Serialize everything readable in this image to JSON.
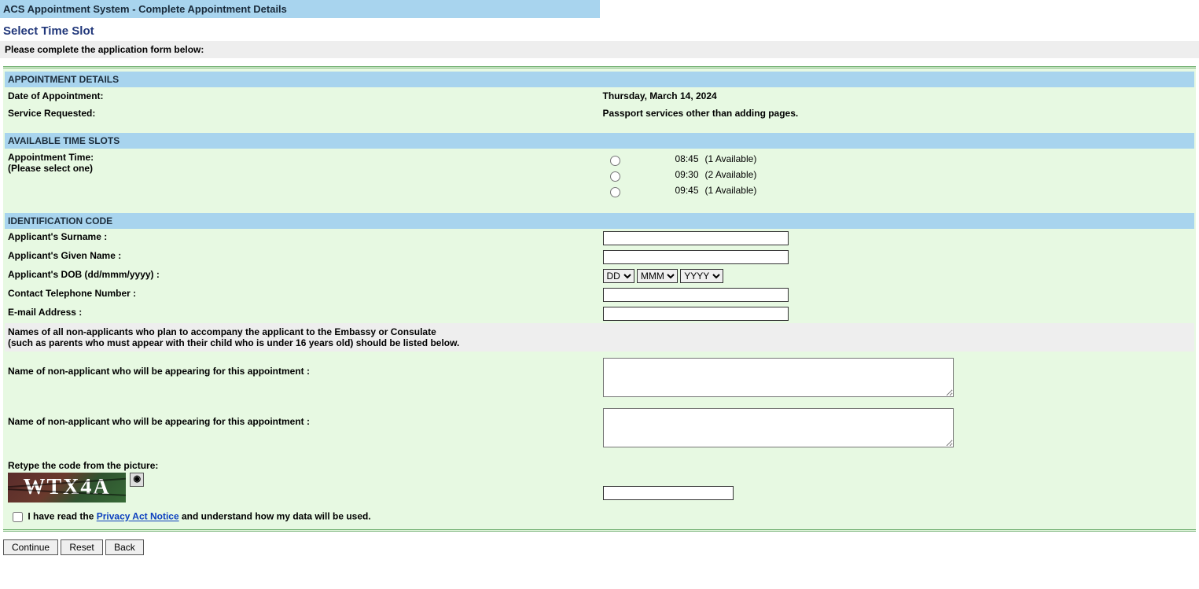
{
  "header": {
    "system_title": "ACS Appointment System - Complete Appointment Details",
    "page_heading": "Select Time Slot",
    "instruction": "Please complete the application form below:"
  },
  "appointment_details": {
    "band": "APPOINTMENT DETAILS",
    "date_label": "Date of Appointment:",
    "date_value": "Thursday, March 14, 2024",
    "service_label": "Service Requested:",
    "service_value": "Passport services other than adding pages."
  },
  "time_slots": {
    "band": "AVAILABLE TIME SLOTS",
    "prompt_line1": "Appointment Time:",
    "prompt_line2": "(Please select one)",
    "slots": [
      {
        "time": "08:45",
        "avail": "(1 Available)"
      },
      {
        "time": "09:30",
        "avail": "(2 Available)"
      },
      {
        "time": "09:45",
        "avail": "(1 Available)"
      }
    ]
  },
  "identification": {
    "band": "IDENTIFICATION CODE",
    "surname_label": "Applicant's Surname :",
    "given_label": "Applicant's Given Name :",
    "dob_label": "Applicant's DOB  (dd/mmm/yyyy) :",
    "dob_dd": "DD",
    "dob_mmm": "MMM",
    "dob_yyyy": "YYYY",
    "phone_label": "Contact Telephone Number :",
    "email_label": "E-mail Address :",
    "note": "Names of all non-applicants who plan to accompany the applicant to the Embassy or Consulate\n(such as parents who must appear with their child who is under 16 years old) should be listed below.",
    "nonapp_label": "Name of non-applicant who will be appearing for this appointment :",
    "captcha_label": "Retype the code from the picture:",
    "captcha_text": "WTX4A",
    "consent_prefix": "I have read the ",
    "consent_link": "Privacy Act Notice",
    "consent_suffix": " and understand how my data will be used."
  },
  "buttons": {
    "continue": "Continue",
    "reset": "Reset",
    "back": "Back"
  }
}
